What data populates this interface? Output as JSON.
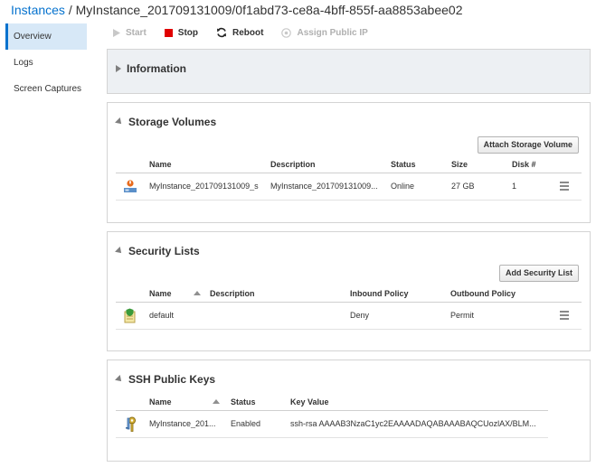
{
  "breadcrumb": {
    "parent": "Instances",
    "separator": " / ",
    "current": "MyInstance_201709131009/0f1abd73-ce8a-4bff-855f-aa8853abee02"
  },
  "sidebar": {
    "items": [
      {
        "label": "Overview",
        "active": true
      },
      {
        "label": "Logs",
        "active": false
      },
      {
        "label": "Screen Captures",
        "active": false
      }
    ]
  },
  "toolbar": {
    "start": "Start",
    "stop": "Stop",
    "reboot": "Reboot",
    "assign_ip": "Assign Public IP"
  },
  "information": {
    "title": "Information"
  },
  "storage": {
    "title": "Storage Volumes",
    "button": "Attach Storage Volume",
    "columns": [
      "Name",
      "Description",
      "Status",
      "Size",
      "Disk #"
    ],
    "rows": [
      {
        "name": "MyInstance_201709131009_s",
        "description": "MyInstance_201709131009...",
        "status": "Online",
        "size": "27 GB",
        "disk": "1"
      }
    ]
  },
  "security": {
    "title": "Security Lists",
    "button": "Add Security List",
    "columns": [
      "Name",
      "Description",
      "Inbound Policy",
      "Outbound Policy"
    ],
    "rows": [
      {
        "name": "default",
        "description": "",
        "inbound": "Deny",
        "outbound": "Permit"
      }
    ]
  },
  "ssh": {
    "title": "SSH Public Keys",
    "columns": [
      "Name",
      "Status",
      "Key Value"
    ],
    "rows": [
      {
        "name": "MyInstance_201...",
        "status": "Enabled",
        "key": "ssh-rsa AAAAB3NzaC1yc2EAAAADAQABAAABAQCUozlAX/BLM..."
      }
    ]
  },
  "colors": {
    "link": "#0572ce",
    "stop": "#e00000",
    "panel_header_bg": "#edf0f3",
    "active_nav_bg": "#d7e8f7"
  }
}
